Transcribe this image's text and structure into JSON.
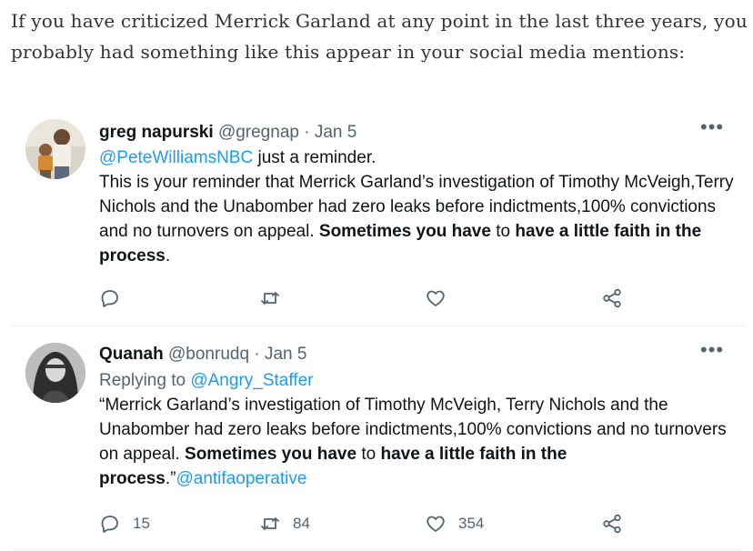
{
  "intro": {
    "text": "If you have criticized Merrick Garland at any point in the last three years, you probably had something like this appear in your social media mentions:"
  },
  "tweets": [
    {
      "display_name": "greg napurski",
      "handle": "@gregnap",
      "separator": "·",
      "date": "Jan 5",
      "more_icon": "more-horizontal-icon",
      "segments": [
        {
          "text": "@PeteWilliamsNBC",
          "style": "link"
        },
        {
          "text": " just a reminder.",
          "style": "plain"
        },
        {
          "text": "\n",
          "style": "break"
        },
        {
          "text": "This is your reminder that Merrick Garland’s investigation of Timothy McVeigh,Terry Nichols and the Unabomber had zero leaks before indictments,100% convictions and no turnovers on appeal. ",
          "style": "plain"
        },
        {
          "text": "Sometimes you have",
          "style": "bold"
        },
        {
          "text": " to ",
          "style": "plain"
        },
        {
          "text": "have a little faith in the process",
          "style": "bold"
        },
        {
          "text": ".",
          "style": "plain"
        }
      ],
      "actions": {
        "reply_count": "",
        "retweet_count": "",
        "like_count": ""
      }
    },
    {
      "display_name": "Quanah",
      "handle": "@bonrudq",
      "separator": "·",
      "date": "Jan 5",
      "more_icon": "more-horizontal-icon",
      "segments": [
        {
          "text": "Replying to ",
          "style": "muted"
        },
        {
          "text": "@Angry_Staffer",
          "style": "link"
        },
        {
          "text": "\n",
          "style": "break"
        },
        {
          "text": "“Merrick Garland’s investigation  of Timothy McVeigh, Terry Nichols and the Unabomber had zero leaks before indictments,100% convictions and no turnovers on appeal. ",
          "style": "plain"
        },
        {
          "text": "Sometimes you have",
          "style": "bold"
        },
        {
          "text": " to ",
          "style": "plain"
        },
        {
          "text": "have a little faith in the process",
          "style": "bold"
        },
        {
          "text": ".”",
          "style": "plain"
        },
        {
          "text": "@antifaoperative",
          "style": "link"
        }
      ],
      "actions": {
        "reply_count": "15",
        "retweet_count": "84",
        "like_count": "354"
      }
    }
  ],
  "icons": {
    "reply": "reply-icon",
    "retweet": "retweet-icon",
    "like": "heart-icon",
    "share": "share-icon"
  },
  "colors": {
    "link": "#1d9bf0",
    "muted": "#536471",
    "text": "#0f1419",
    "divider": "#eff3f4"
  }
}
